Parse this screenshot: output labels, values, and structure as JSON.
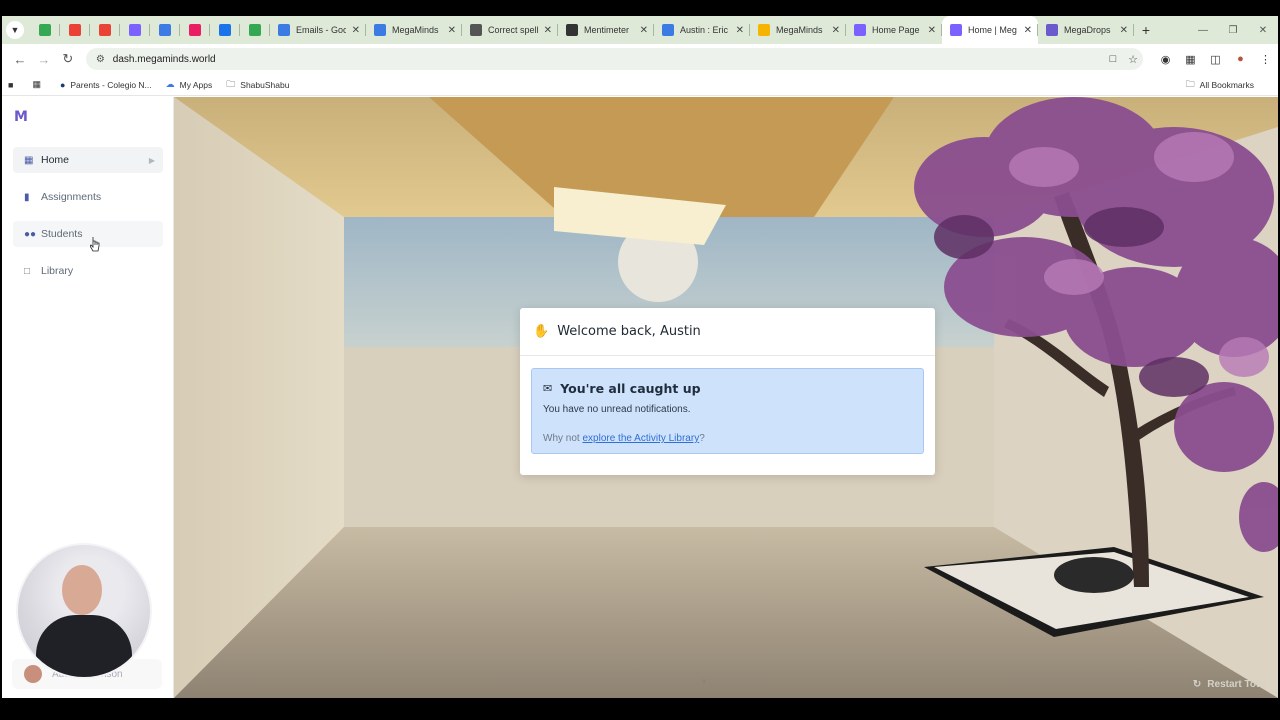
{
  "browser": {
    "tabs": [
      {
        "label": "Emails - Goo",
        "color": "#3b7be3"
      },
      {
        "label": "MegaMinds",
        "color": "#3b7be3"
      },
      {
        "label": "Correct spelli",
        "color": "#555555"
      },
      {
        "label": "Mentimeter",
        "color": "#333333"
      },
      {
        "label": "Austin : Eric",
        "color": "#3b7be3"
      },
      {
        "label": "MegaMinds",
        "color": "#f4b400"
      },
      {
        "label": "Home Page",
        "color": "#7b61ff"
      },
      {
        "label": "Home | Meg",
        "color": "#7b61ff",
        "active": true
      },
      {
        "label": "MegaDrops",
        "color": "#6a5acd"
      }
    ],
    "pinned_colors": [
      "#34a853",
      "#ea4335",
      "#ea4335",
      "#7b61ff",
      "#3b7be3",
      "#e91e63",
      "#1a73e8",
      "#34a853"
    ],
    "url": "dash.megaminds.world",
    "bookmarks": [
      "Parents - Colegio N...",
      "My Apps",
      "ShabuShabu"
    ],
    "all_bookmarks": "All Bookmarks"
  },
  "sidebar": {
    "logo": "M",
    "items": [
      {
        "label": "Home",
        "icon": "dashboard-icon"
      },
      {
        "label": "Assignments",
        "icon": "clipboard-icon"
      },
      {
        "label": "Students",
        "icon": "people-icon"
      },
      {
        "label": "Library",
        "icon": "folder-icon"
      }
    ],
    "user_name": "Austin Levinson"
  },
  "welcome": {
    "greeting": "Welcome back, Austin",
    "notice_title": "You're all caught up",
    "notice_body": "You have no unread notifications.",
    "prompt_prefix": "Why not ",
    "prompt_link": "explore the Activity Library",
    "prompt_suffix": "?"
  },
  "restart_tour": "Restart Tour"
}
